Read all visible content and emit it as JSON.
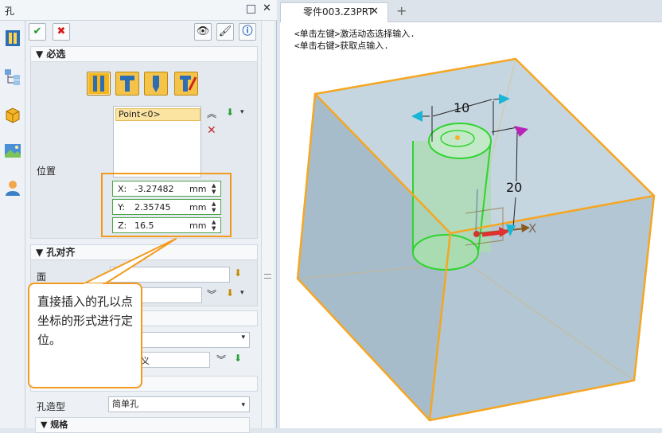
{
  "panel": {
    "title": "孔",
    "tools": {
      "eye": "👁",
      "brush": "🖌",
      "info": "ⓘ"
    }
  },
  "sections": {
    "required": "必选",
    "position_label": "位置",
    "point_item": "Point<0>",
    "align": "孔对齐",
    "face_label": "面",
    "hole_shape_label": "孔造型",
    "hole_shape_value": "简单孔",
    "spec": "规格"
  },
  "coords": {
    "x": {
      "label": "X:",
      "value": "-3.27482",
      "unit": "mm"
    },
    "y": {
      "label": "Y:",
      "value": "2.35745",
      "unit": "mm"
    },
    "z": {
      "label": "Z:",
      "value": "16.5",
      "unit": "mm"
    }
  },
  "callout": "直接插入的孔以点坐标的形式进行定位。",
  "callout_tail_fragment": "义",
  "doc": {
    "tab_title": "零件003.Z3PRT",
    "hint1": "<单击左键>激活动态选择输入.",
    "hint2": "<单击右键>获取点输入.",
    "dim_top": "10",
    "dim_side": "20",
    "axis_x": "X"
  },
  "colors": {
    "accent": "#f39a1e",
    "box_edge": "#f5a623",
    "box_fill": "#b9ccd8",
    "cyl_edge": "#2fd42f"
  }
}
